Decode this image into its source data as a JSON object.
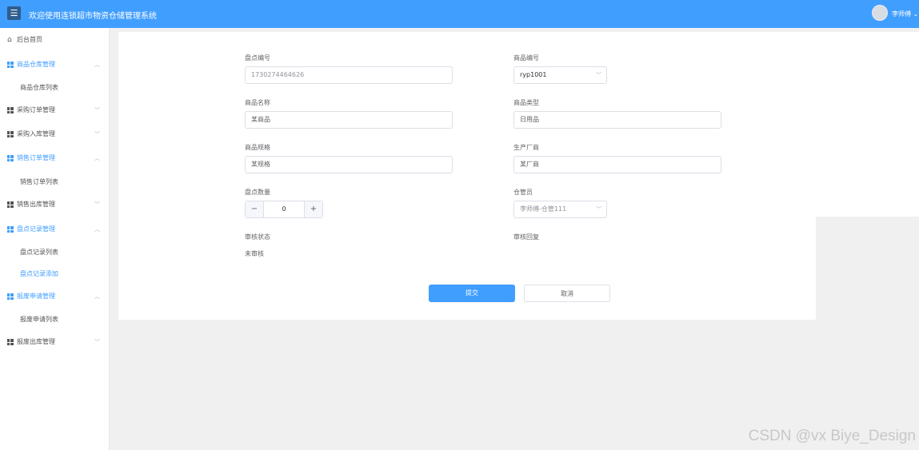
{
  "header": {
    "title": "欢迎使用连锁超市物资仓储管理系统",
    "user": "李师傅"
  },
  "sidebar": {
    "home": "后台首页",
    "groups": [
      {
        "label": "商品仓库管理",
        "expanded": true,
        "subs": [
          "商品仓库列表"
        ]
      },
      {
        "label": "采购订单管理",
        "expanded": false
      },
      {
        "label": "采购入库管理",
        "expanded": false
      },
      {
        "label": "销售订单管理",
        "expanded": true,
        "subs": [
          "销售订单列表"
        ]
      },
      {
        "label": "销售出库管理",
        "expanded": false
      },
      {
        "label": "盘点记录管理",
        "expanded": true,
        "subs": [
          "盘点记录列表",
          "盘点记录添加"
        ]
      },
      {
        "label": "报废申请管理",
        "expanded": true,
        "subs": [
          "报废申请列表"
        ]
      },
      {
        "label": "报废出库管理",
        "expanded": false
      }
    ]
  },
  "form": {
    "inventory_no": {
      "label": "盘点编号",
      "value": "1730274464626"
    },
    "product_no": {
      "label": "商品编号",
      "value": "ryp1001"
    },
    "product_name": {
      "label": "商品名称",
      "value": "某商品"
    },
    "product_type": {
      "label": "商品类型",
      "value": "日用品"
    },
    "product_spec": {
      "label": "商品规格",
      "value": "某规格"
    },
    "manufacturer": {
      "label": "生产厂商",
      "value": "某厂商"
    },
    "quantity": {
      "label": "盘点数量",
      "value": "0",
      "minus": "−",
      "plus": "+"
    },
    "keeper": {
      "label": "仓管员",
      "value": "李师傅-仓管111"
    },
    "review_status": {
      "label": "审核状态",
      "value": "未审核"
    },
    "review_reply": {
      "label": "审核回复"
    },
    "submit": "提交",
    "cancel": "取消"
  },
  "watermark": "CSDN @vx Biye_Design"
}
